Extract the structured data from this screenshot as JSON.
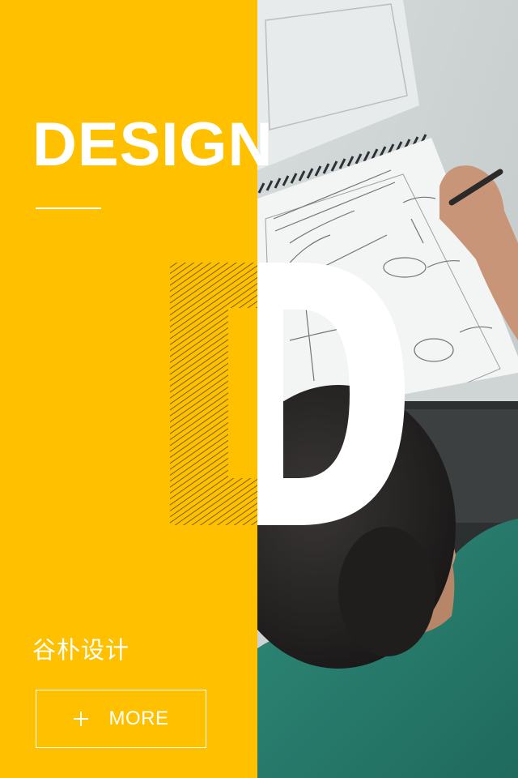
{
  "hero": {
    "title": "DESIGN",
    "big_letter": "D",
    "brand_name": "谷朴设计",
    "cta_label": "MORE",
    "accent_color": "#FFC000",
    "text_color": "#FFFFFF"
  },
  "icons": {
    "cta_icon": "plus-icon"
  }
}
